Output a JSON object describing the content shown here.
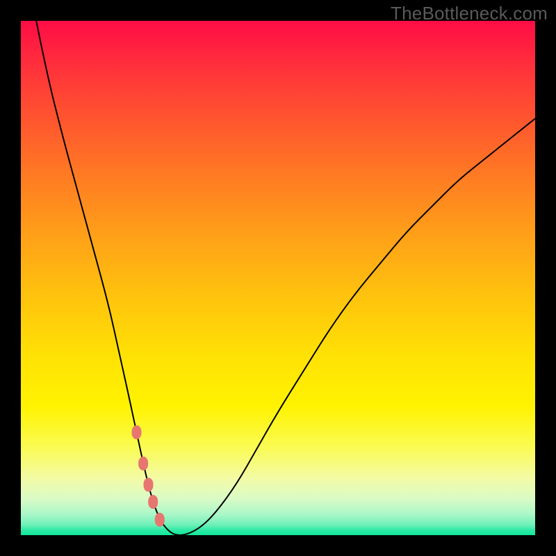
{
  "watermark": "TheBottleneck.com",
  "colors": {
    "frame_bg": "#000000",
    "gradient_top": "#ff0c46",
    "gradient_bottom": "#0fe79a",
    "curve_stroke": "#000000",
    "marker_fill": "#e6766f"
  },
  "chart_data": {
    "type": "line",
    "title": "",
    "xlabel": "",
    "ylabel": "",
    "xlim": [
      0,
      100
    ],
    "ylim": [
      0,
      100
    ],
    "x": [
      3,
      5,
      8,
      11,
      14,
      17,
      19,
      21,
      22.5,
      24,
      25.5,
      27,
      28.5,
      30,
      32,
      35,
      38,
      42,
      46,
      50,
      55,
      60,
      65,
      70,
      75,
      80,
      85,
      90,
      95,
      100
    ],
    "values": [
      100,
      90,
      78,
      67,
      56,
      45,
      36,
      27,
      20,
      13,
      7,
      3,
      1,
      0,
      0,
      1.5,
      4.5,
      10,
      17,
      24,
      32,
      40,
      47,
      53,
      59,
      64,
      69,
      73,
      77,
      81
    ],
    "green_threshold": 4,
    "markers_x": [
      22.5,
      27,
      23.8,
      25.7,
      24.8
    ]
  }
}
